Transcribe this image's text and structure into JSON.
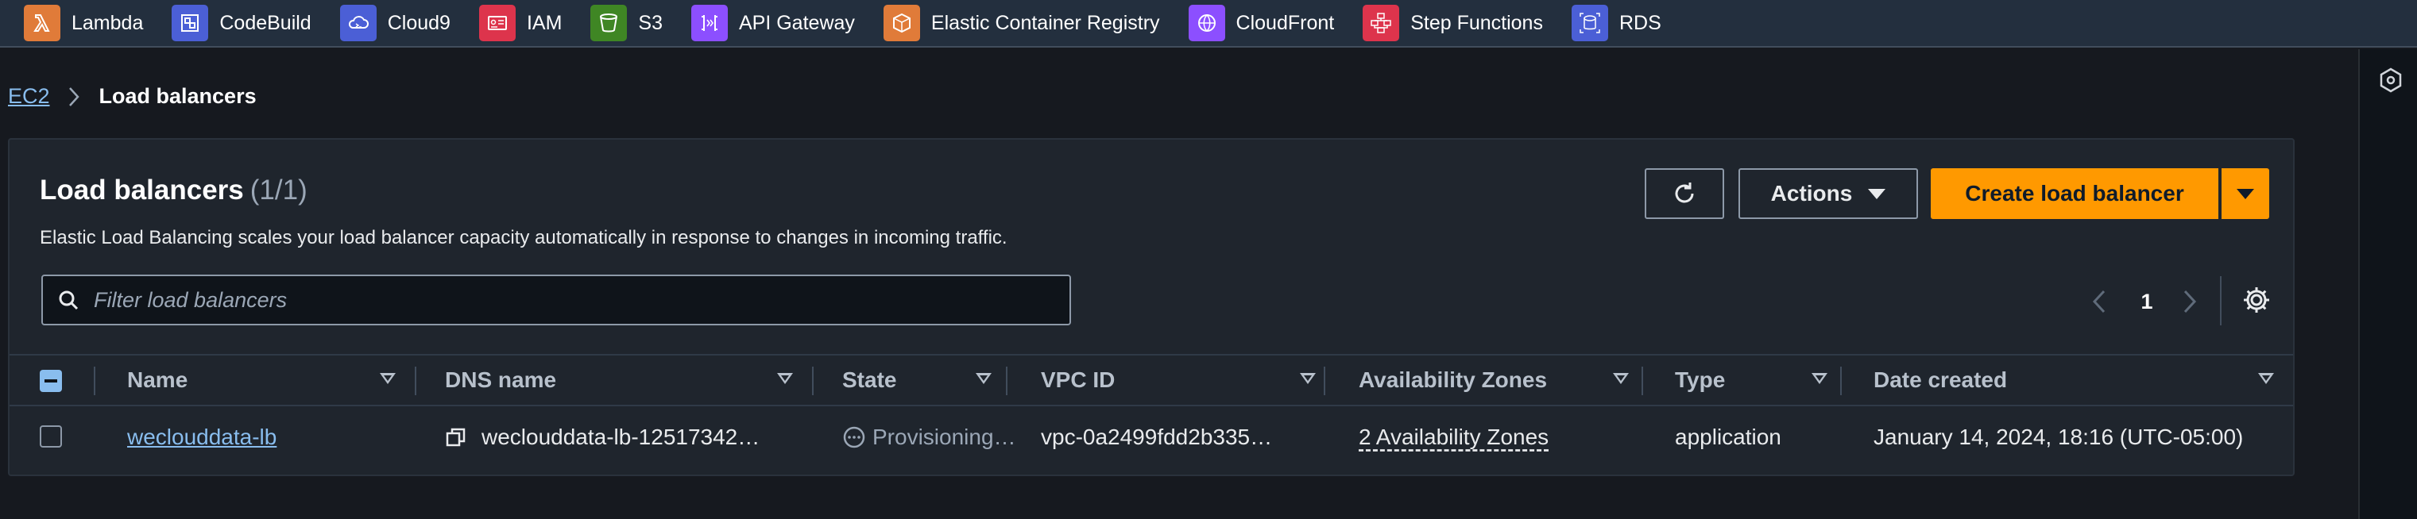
{
  "favorites": [
    {
      "label": "Lambda",
      "icon": "lambda-icon",
      "color": "#e07b39"
    },
    {
      "label": "CodeBuild",
      "icon": "codebuild-icon",
      "color": "#4b5fd6"
    },
    {
      "label": "Cloud9",
      "icon": "cloud9-icon",
      "color": "#4b5fd6"
    },
    {
      "label": "IAM",
      "icon": "iam-icon",
      "color": "#dd344c"
    },
    {
      "label": "S3",
      "icon": "s3-icon",
      "color": "#3f8624"
    },
    {
      "label": "API Gateway",
      "icon": "api-gateway-icon",
      "color": "#8c4fff"
    },
    {
      "label": "Elastic Container Registry",
      "icon": "ecr-icon",
      "color": "#e07b39"
    },
    {
      "label": "CloudFront",
      "icon": "cloudfront-icon",
      "color": "#8c4fff"
    },
    {
      "label": "Step Functions",
      "icon": "step-functions-icon",
      "color": "#dd344c"
    },
    {
      "label": "RDS",
      "icon": "rds-icon",
      "color": "#4b5fd6"
    }
  ],
  "breadcrumb": {
    "parent": "EC2",
    "current": "Load balancers"
  },
  "header": {
    "title": "Load balancers",
    "count": "(1/1)",
    "description": "Elastic Load Balancing scales your load balancer capacity automatically in response to changes in incoming traffic."
  },
  "actions": {
    "actions_label": "Actions",
    "create_label": "Create load balancer"
  },
  "filter": {
    "placeholder": "Filter load balancers",
    "value": ""
  },
  "pagination": {
    "current_page": "1"
  },
  "table": {
    "columns": [
      "Name",
      "DNS name",
      "State",
      "VPC ID",
      "Availability Zones",
      "Type",
      "Date created"
    ],
    "rows": [
      {
        "name": "weclouddata-lb",
        "dns_name": "weclouddata-lb-12517342…",
        "state": "Provisioning…",
        "vpc_id": "vpc-0a2499fdd2b335…",
        "availability_zones": "2 Availability Zones",
        "type": "application",
        "date_created": "January 14, 2024, 18:16 (UTC-05:00)"
      }
    ]
  },
  "colors": {
    "primary_button": "#ff9900",
    "link": "#89bdee",
    "nav_bg": "#232f3e"
  }
}
